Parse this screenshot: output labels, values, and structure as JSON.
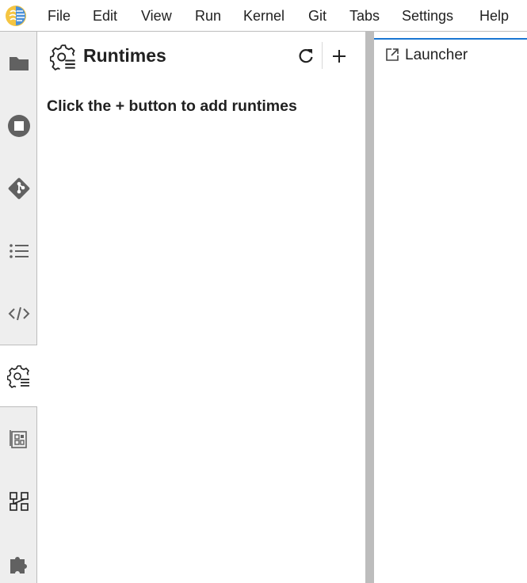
{
  "menubar": {
    "logo_icon": "jupyter-brain-logo-icon",
    "items": [
      "File",
      "Edit",
      "View",
      "Run",
      "Kernel",
      "Git",
      "Tabs",
      "Settings",
      "Help"
    ]
  },
  "leftbar": {
    "items": [
      {
        "icon": "folder-icon",
        "active": false
      },
      {
        "icon": "stop-circle-icon",
        "active": false
      },
      {
        "icon": "git-icon",
        "active": false
      },
      {
        "icon": "list-icon",
        "active": false
      },
      {
        "icon": "code-icon",
        "active": false
      },
      {
        "icon": "runtimes-gear-icon",
        "active": true
      },
      {
        "icon": "component-catalog-icon",
        "active": false
      },
      {
        "icon": "pipeline-nodes-icon",
        "active": false
      },
      {
        "icon": "puzzle-piece-icon",
        "active": false
      }
    ]
  },
  "panel": {
    "title": "Runtimes",
    "empty_message": "Click the + button to add runtimes",
    "refresh_icon": "refresh-icon",
    "add_icon": "plus-icon"
  },
  "main": {
    "tabs": [
      {
        "label": "Launcher",
        "icon": "launcher-external-icon",
        "active": true
      }
    ]
  },
  "colors": {
    "accent": "#1976d2",
    "sidebar_bg": "#eeeeee",
    "border": "#bdbdbd",
    "icon": "#616161"
  }
}
